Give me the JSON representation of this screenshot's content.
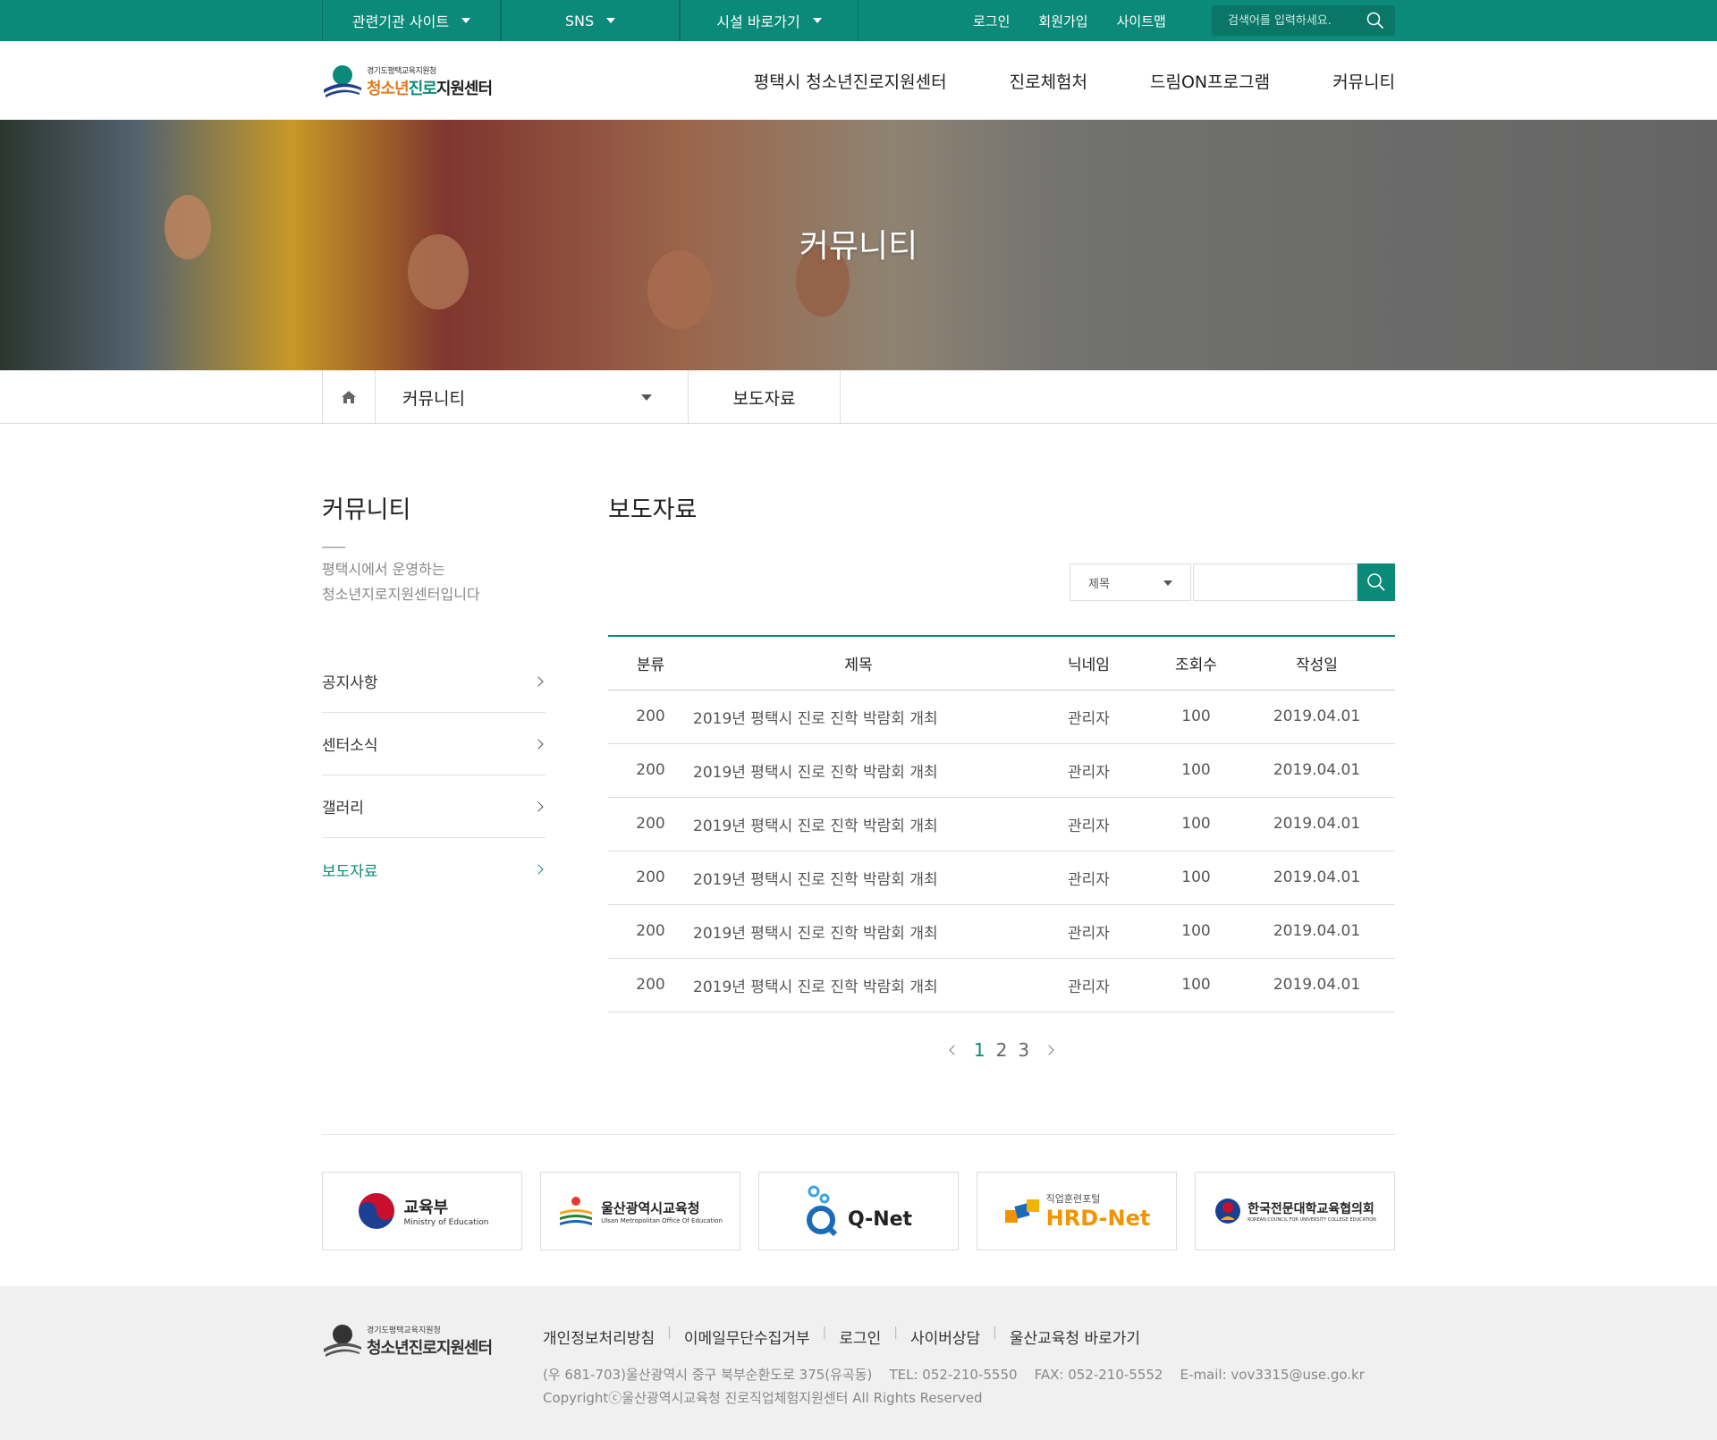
{
  "topbar": {
    "dropdowns": [
      {
        "label": "관련기관 사이트"
      },
      {
        "label": "SNS"
      },
      {
        "label": "시설 바로가기"
      }
    ],
    "links": [
      "로그인",
      "회원가입",
      "사이트맵"
    ],
    "search_placeholder": "검색어를 입력하세요."
  },
  "header": {
    "logo_small": "경기도평택교육지원청",
    "logo_big_a": "청소년",
    "logo_big_b": "진로",
    "logo_big_c": "지원센터",
    "nav": [
      "평택시 청소년진로지원센터",
      "진로체험처",
      "드림ON프로그램",
      "커뮤니티"
    ]
  },
  "hero": {
    "title": "커뮤니티"
  },
  "location": {
    "section": "커뮤니티",
    "current": "보도자료"
  },
  "sidebar": {
    "title": "커뮤니티",
    "desc_line1": "평택시에서 운영하는",
    "desc_line2": "청소년지로지원센터입니다",
    "items": [
      {
        "label": "공지사항",
        "active": false
      },
      {
        "label": "센터소식",
        "active": false
      },
      {
        "label": "갤러리",
        "active": false
      },
      {
        "label": "보도자료",
        "active": true
      }
    ]
  },
  "content": {
    "title": "보도자료",
    "search_select": "제목",
    "columns": [
      "분류",
      "제목",
      "닉네임",
      "조회수",
      "작성일"
    ],
    "rows": [
      {
        "cat": "200",
        "subject": "2019년 평택시 진로 진학 박람회 개최",
        "nick": "관리자",
        "views": "100",
        "date": "2019.04.01"
      },
      {
        "cat": "200",
        "subject": "2019년 평택시 진로 진학 박람회 개최",
        "nick": "관리자",
        "views": "100",
        "date": "2019.04.01"
      },
      {
        "cat": "200",
        "subject": "2019년 평택시 진로 진학 박람회 개최",
        "nick": "관리자",
        "views": "100",
        "date": "2019.04.01"
      },
      {
        "cat": "200",
        "subject": "2019년 평택시 진로 진학 박람회 개최",
        "nick": "관리자",
        "views": "100",
        "date": "2019.04.01"
      },
      {
        "cat": "200",
        "subject": "2019년 평택시 진로 진학 박람회 개최",
        "nick": "관리자",
        "views": "100",
        "date": "2019.04.01"
      },
      {
        "cat": "200",
        "subject": "2019년 평택시 진로 진학 박람회 개최",
        "nick": "관리자",
        "views": "100",
        "date": "2019.04.01"
      }
    ],
    "pages": [
      "1",
      "2",
      "3"
    ],
    "current_page": "1"
  },
  "banners": [
    {
      "name": "교육부",
      "sub": "Ministry of Education"
    },
    {
      "name": "울산광역시교육청",
      "sub": "Ulsan Metropolitan Office Of Education"
    },
    {
      "name": "Q-Net",
      "sub": ""
    },
    {
      "name": "HRD-Net",
      "sub": "직업훈련포털"
    },
    {
      "name": "한국전문대학교육협의회",
      "sub": "KOREAN COUNCIL FOR UNIVERSITY COLLEGE EDUCATION"
    }
  ],
  "footer": {
    "links": [
      "개인정보처리방침",
      "이메일무단수집거부",
      "로그인",
      "사이버상담",
      "울산교육청 바로가기"
    ],
    "address": "(우 681-703)울산광역시 중구 북부순환도로 375(유곡동)    TEL: 052-210-5550    FAX: 052-210-5552    E-mail: vov3315@use.go.kr",
    "copyright": "Copyrightⓒ울산광역시교육청 진로직업체험지원센터 All Rights Reserved"
  },
  "colors": {
    "brand": "#0b8a79",
    "logo_orange": "#e07b1a",
    "logo_green": "#0b8a79"
  }
}
